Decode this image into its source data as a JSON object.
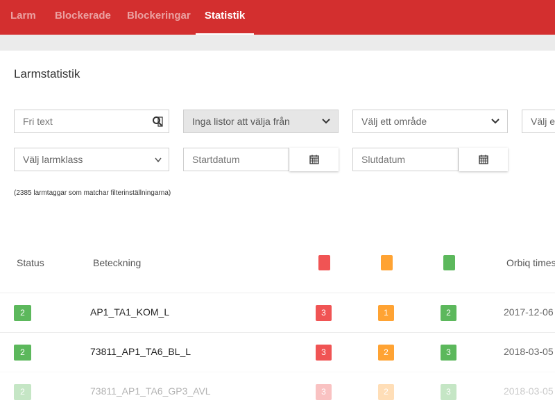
{
  "nav": {
    "tabs": [
      {
        "label": "Larm",
        "active": false
      },
      {
        "label": "Blockerade",
        "active": false
      },
      {
        "label": "Blockeringar",
        "active": false
      },
      {
        "label": "Statistik",
        "active": true
      }
    ]
  },
  "page": {
    "title": "Larmstatistik"
  },
  "filters": {
    "free_text_placeholder": "Fri text",
    "list_select": "Inga listor att välja från",
    "area_select": "Välj ett område",
    "extra_select": "Välj ett",
    "alarm_class_select": "Välj larmklass",
    "start_date_placeholder": "Startdatum",
    "end_date_placeholder": "Slutdatum"
  },
  "match_note": "(2385 larmtaggar som matchar filterinställningarna)",
  "table": {
    "headers": {
      "status": "Status",
      "designation": "Beteckning",
      "timestamp": "Orbiq times"
    },
    "severity_colors": {
      "red": "#f05454",
      "orange": "#ffa333",
      "green": "#5cb85c"
    },
    "rows": [
      {
        "status": "2",
        "name": "AP1_TA1_KOM_L",
        "red": "3",
        "orange": "1",
        "green": "2",
        "timestamp": "2017-12-06"
      },
      {
        "status": "2",
        "name": "73811_AP1_TA6_BL_L",
        "red": "3",
        "orange": "2",
        "green": "3",
        "timestamp": "2018-03-05"
      },
      {
        "status": "2",
        "name": "73811_AP1_TA6_GP3_AVL",
        "red": "3",
        "orange": "2",
        "green": "3",
        "timestamp": "2018-03-05"
      }
    ]
  },
  "colors": {
    "brand": "#d32f2f",
    "status_green": "#5cb85c"
  },
  "icons": [
    "search-icon",
    "chevron-down-icon",
    "calendar-icon"
  ]
}
